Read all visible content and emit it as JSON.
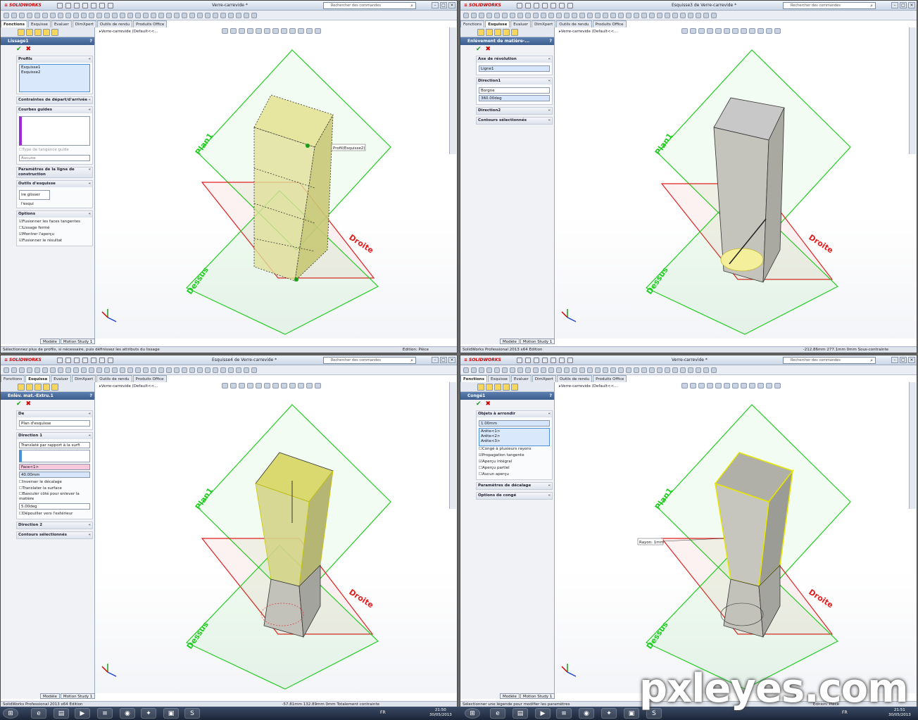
{
  "app": {
    "logo": "SOLIDWORKS",
    "search_placeholder": "Rechercher des commandes"
  },
  "tabs": [
    "Fonctions",
    "Esquisse",
    "Evaluer",
    "DimXpert",
    "Outils de rendu",
    "Produits Office"
  ],
  "tree_root": "Verre-carrevide  (Default<<...",
  "quads": [
    {
      "title": "Verre-carrevide *",
      "active_tab": 0,
      "pm_title": "Lissage1",
      "status": "Sélectionnez plus de profils, si nécessaire, puis définissez les attributs du lissage",
      "status_right": "Edition: Pièce",
      "groups": {
        "profils": "Profils",
        "profil1": "Esquisse1",
        "profil2": "Esquisse2",
        "contraintes": "Contraintes de départ/d'arrivée",
        "courbes": "Courbes guides",
        "tangence": "Type de tangence guide",
        "aucune": "Aucune",
        "params": "Paramètres de la ligne de construction",
        "outils": "Outils d'esquisse",
        "glisser": "ire glisser l'esqui",
        "options": "Options",
        "opt1": "Fusionner les faces tangentes",
        "opt2": "Lissage fermé",
        "opt3": "Montrer l'aperçu",
        "opt4": "Fusionner le résultat"
      },
      "callout": "Profil(Esquisse2)"
    },
    {
      "title": "Esquisse3 de Verre-carrevide *",
      "active_tab": 1,
      "pm_title": "Enlèvement de matière-...",
      "status": "SolidWorks Professional 2013 x64 Edition",
      "status_right": "-212.86mm   277.1mm   0mm   Sous-contrainte",
      "groups": {
        "axe": "Axe de révolution",
        "ligne": "Ligne1",
        "dir1": "Direction1",
        "borgne": "Borgne",
        "angle": "360.00deg",
        "dir2": "Direction2",
        "contours": "Contours sélectionnés"
      }
    },
    {
      "title": "Esquisse4 de Verre-carrevide *",
      "active_tab": 1,
      "pm_title": "Enlèv. mat.-Extru.1",
      "status": "SolidWorks Professional 2013 x64 Edition",
      "status_right": "-57.81mm   132.89mm   0mm   Totalement contrainte",
      "groups": {
        "de": "De",
        "plan": "Plan d'esquisse",
        "dir1": "Direction 1",
        "translate": "Translaté par rapport à la surfi",
        "face": "Face<1>",
        "dist": "40.00mm",
        "inv": "Inverser le décalage",
        "transsurf": "Translater la surface",
        "basculer": "Basculer côté pour enlever la matière",
        "angle": "5.00deg",
        "depouiller": "Dépouiller vers l'extérieur",
        "dir2": "Direction 2",
        "contours": "Contours sélectionnés"
      }
    },
    {
      "title": "Verre-carrevide *",
      "active_tab": 0,
      "pm_title": "Congé1",
      "status": "Sélectionner une légende pour modifier les paramètres",
      "status_right": "Edition: Pièce",
      "groups": {
        "objets": "Objets à arrondir",
        "rayon": "1.00mm",
        "a1": "Arête<1>",
        "a2": "Arête<2>",
        "a3": "Arête<3>",
        "plusieurs": "Congé à plusieurs rayons",
        "propagation": "Propagation tangente",
        "integral": "Aperçu intégral",
        "partiel": "Aperçu partiel",
        "aucun": "Aucun aperçu",
        "decalage": "Paramètres de décalage",
        "options": "Options de congé"
      },
      "callout": "Rayon:  1mm"
    }
  ],
  "planes": {
    "plan1": "Plan1",
    "droite": "Droite",
    "dessus": "Dessus"
  },
  "model_tabs": [
    "Modèle",
    "Motion Study 1"
  ],
  "clock": [
    {
      "time": "21:50",
      "date": "30/05/2013"
    },
    {
      "time": "21:51",
      "date": "30/05/2013"
    }
  ],
  "lang": "FR",
  "watermark": "pxleyes.com",
  "colors": {
    "plane_green": "#22cc22",
    "plane_red": "#e02020",
    "accent": "#3c5d8d"
  }
}
